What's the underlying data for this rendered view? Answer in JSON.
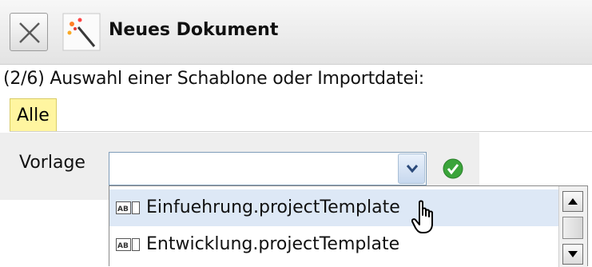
{
  "header": {
    "title": "Neues Dokument",
    "close_icon": "close-icon",
    "app_icon": "magic-wand-icon"
  },
  "step": {
    "label": "(2/6) Auswahl einer Schablone oder Importdatei:"
  },
  "tabs": [
    {
      "label": "Alle",
      "active": true
    }
  ],
  "form": {
    "field_label": "Vorlage",
    "input_value": "",
    "status_icon": "check-ok-icon",
    "accent_color": "#3aa43a"
  },
  "dropdown": {
    "items": [
      {
        "label": "Einfuehrung.projectTemplate",
        "icon": "text-field-icon",
        "selected": true
      },
      {
        "label": "Entwicklung.projectTemplate",
        "icon": "text-field-icon",
        "selected": false
      }
    ]
  },
  "colors": {
    "tab_active_bg": "#fff5a0",
    "selected_row_bg": "#dde8f6"
  }
}
